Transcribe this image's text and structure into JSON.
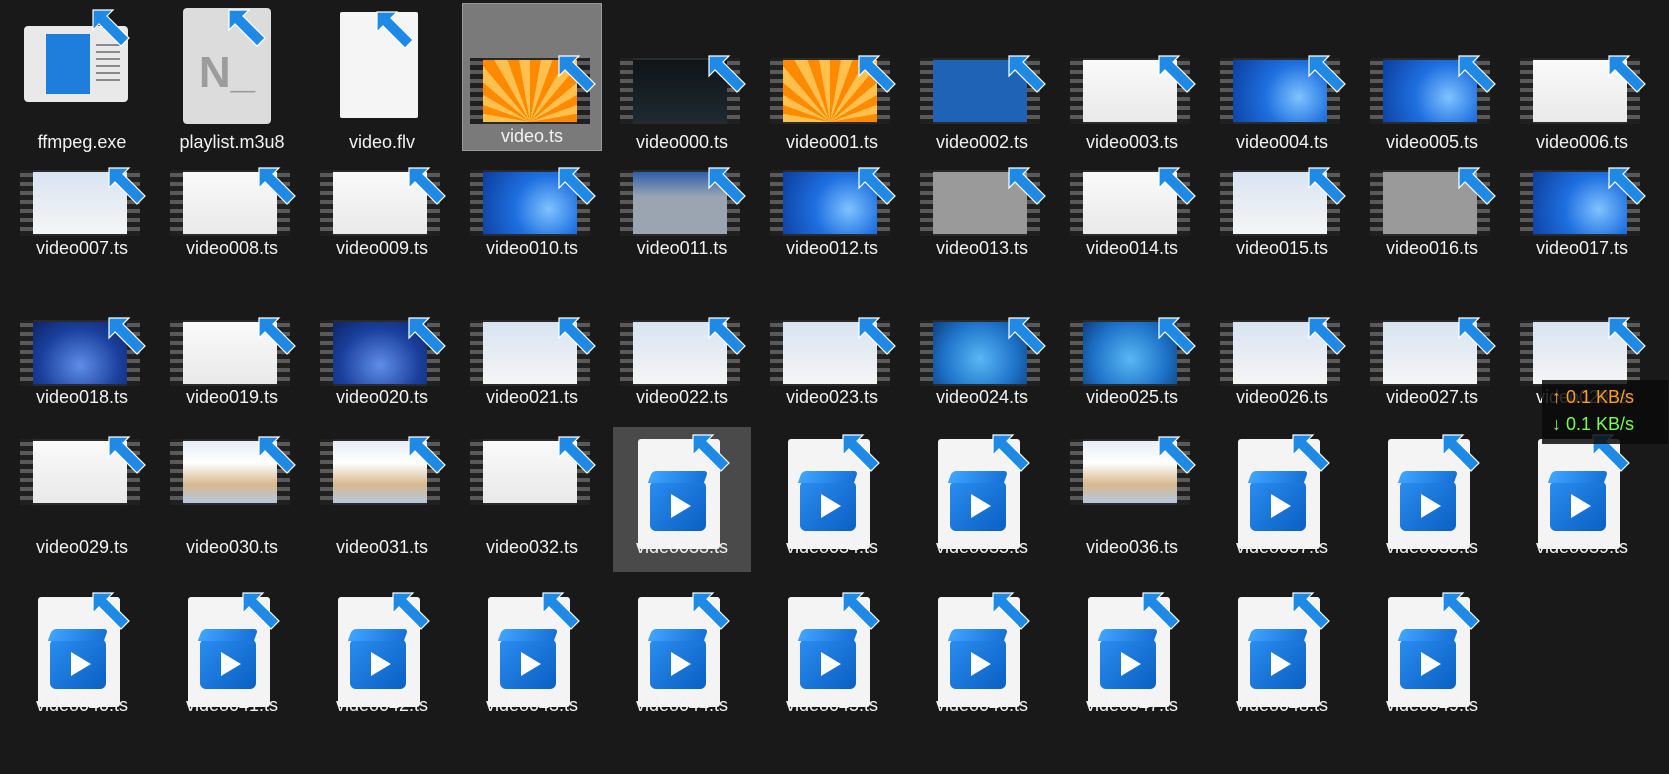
{
  "colors": {
    "background": "#191919",
    "up": "#ff9f1c",
    "down": "#7cff4c",
    "accent": "#1a73e8"
  },
  "files": [
    {
      "name": "ffmpeg.exe",
      "icon": "exe-window-icon",
      "kind": "exe"
    },
    {
      "name": "playlist.m3u8",
      "icon": "document-n-icon",
      "kind": "m3u8"
    },
    {
      "name": "video.flv",
      "icon": "blank-document-icon",
      "kind": "blank"
    },
    {
      "name": "video.ts",
      "icon": "video-thumbnail",
      "kind": "thumb",
      "thumb": "orange",
      "state": "hover"
    },
    {
      "name": "video000.ts",
      "icon": "video-thumbnail",
      "kind": "thumb",
      "thumb": "dark"
    },
    {
      "name": "video001.ts",
      "icon": "video-thumbnail",
      "kind": "thumb",
      "thumb": "orange"
    },
    {
      "name": "video002.ts",
      "icon": "video-thumbnail",
      "kind": "thumb",
      "thumb": "bsod"
    },
    {
      "name": "video003.ts",
      "icon": "video-thumbnail",
      "kind": "thumb",
      "thumb": "white"
    },
    {
      "name": "video004.ts",
      "icon": "video-thumbnail",
      "kind": "thumb",
      "thumb": "win11"
    },
    {
      "name": "video005.ts",
      "icon": "video-thumbnail",
      "kind": "thumb",
      "thumb": "win11"
    },
    {
      "name": "video006.ts",
      "icon": "video-thumbnail",
      "kind": "thumb",
      "thumb": "white"
    },
    {
      "name": "video007.ts",
      "icon": "video-thumbnail",
      "kind": "thumb",
      "thumb": "dialog"
    },
    {
      "name": "video008.ts",
      "icon": "video-thumbnail",
      "kind": "thumb",
      "thumb": "white"
    },
    {
      "name": "video009.ts",
      "icon": "video-thumbnail",
      "kind": "thumb",
      "thumb": "white"
    },
    {
      "name": "video010.ts",
      "icon": "video-thumbnail",
      "kind": "thumb",
      "thumb": "win11"
    },
    {
      "name": "video011.ts",
      "icon": "video-thumbnail",
      "kind": "thumb",
      "thumb": "grayblue"
    },
    {
      "name": "video012.ts",
      "icon": "video-thumbnail",
      "kind": "thumb",
      "thumb": "win11"
    },
    {
      "name": "video013.ts",
      "icon": "video-thumbnail",
      "kind": "thumb",
      "thumb": "gray"
    },
    {
      "name": "video014.ts",
      "icon": "video-thumbnail",
      "kind": "thumb",
      "thumb": "white"
    },
    {
      "name": "video015.ts",
      "icon": "video-thumbnail",
      "kind": "thumb",
      "thumb": "dialog"
    },
    {
      "name": "video016.ts",
      "icon": "video-thumbnail",
      "kind": "thumb",
      "thumb": "gray"
    },
    {
      "name": "video017.ts",
      "icon": "video-thumbnail",
      "kind": "thumb",
      "thumb": "win11"
    },
    {
      "name": "video018.ts",
      "icon": "video-thumbnail",
      "kind": "thumb",
      "thumb": "vista"
    },
    {
      "name": "video019.ts",
      "icon": "video-thumbnail",
      "kind": "thumb",
      "thumb": "white"
    },
    {
      "name": "video020.ts",
      "icon": "video-thumbnail",
      "kind": "thumb",
      "thumb": "vista"
    },
    {
      "name": "video021.ts",
      "icon": "video-thumbnail",
      "kind": "thumb",
      "thumb": "dialog"
    },
    {
      "name": "video022.ts",
      "icon": "video-thumbnail",
      "kind": "thumb",
      "thumb": "dialog"
    },
    {
      "name": "video023.ts",
      "icon": "video-thumbnail",
      "kind": "thumb",
      "thumb": "dialog"
    },
    {
      "name": "video024.ts",
      "icon": "video-thumbnail",
      "kind": "thumb",
      "thumb": "win7"
    },
    {
      "name": "video025.ts",
      "icon": "video-thumbnail",
      "kind": "thumb",
      "thumb": "win7"
    },
    {
      "name": "video026.ts",
      "icon": "video-thumbnail",
      "kind": "thumb",
      "thumb": "dialog"
    },
    {
      "name": "video027.ts",
      "icon": "video-thumbnail",
      "kind": "thumb",
      "thumb": "dialog"
    },
    {
      "name": "video028.ts",
      "icon": "video-thumbnail",
      "kind": "thumb",
      "thumb": "dialog"
    },
    {
      "name": "video029.ts",
      "icon": "video-thumbnail",
      "kind": "thumb",
      "thumb": "white"
    },
    {
      "name": "video030.ts",
      "icon": "video-thumbnail",
      "kind": "thumb",
      "thumb": "web"
    },
    {
      "name": "video031.ts",
      "icon": "video-thumbnail",
      "kind": "thumb",
      "thumb": "web"
    },
    {
      "name": "video032.ts",
      "icon": "video-thumbnail",
      "kind": "thumb",
      "thumb": "white"
    },
    {
      "name": "video033.ts",
      "icon": "media-file-icon",
      "kind": "media",
      "state": "selected"
    },
    {
      "name": "video034.ts",
      "icon": "media-file-icon",
      "kind": "media"
    },
    {
      "name": "video035.ts",
      "icon": "media-file-icon",
      "kind": "media"
    },
    {
      "name": "video036.ts",
      "icon": "video-thumbnail",
      "kind": "thumb",
      "thumb": "web"
    },
    {
      "name": "video037.ts",
      "icon": "media-file-icon",
      "kind": "media"
    },
    {
      "name": "video038.ts",
      "icon": "media-file-icon",
      "kind": "media"
    },
    {
      "name": "video039.ts",
      "icon": "media-file-icon",
      "kind": "media"
    },
    {
      "name": "video040.ts",
      "icon": "media-file-icon",
      "kind": "media"
    },
    {
      "name": "video041.ts",
      "icon": "media-file-icon",
      "kind": "media"
    },
    {
      "name": "video042.ts",
      "icon": "media-file-icon",
      "kind": "media"
    },
    {
      "name": "video043.ts",
      "icon": "media-file-icon",
      "kind": "media"
    },
    {
      "name": "video044.ts",
      "icon": "media-file-icon",
      "kind": "media"
    },
    {
      "name": "video045.ts",
      "icon": "media-file-icon",
      "kind": "media"
    },
    {
      "name": "video046.ts",
      "icon": "media-file-icon",
      "kind": "media"
    },
    {
      "name": "video047.ts",
      "icon": "media-file-icon",
      "kind": "media"
    },
    {
      "name": "video048.ts",
      "icon": "media-file-icon",
      "kind": "media"
    },
    {
      "name": "video049.ts",
      "icon": "media-file-icon",
      "kind": "media"
    }
  ],
  "netmeter": {
    "up": "↑ 0.1 KB/s",
    "down": "↓ 0.1 KB/s"
  }
}
